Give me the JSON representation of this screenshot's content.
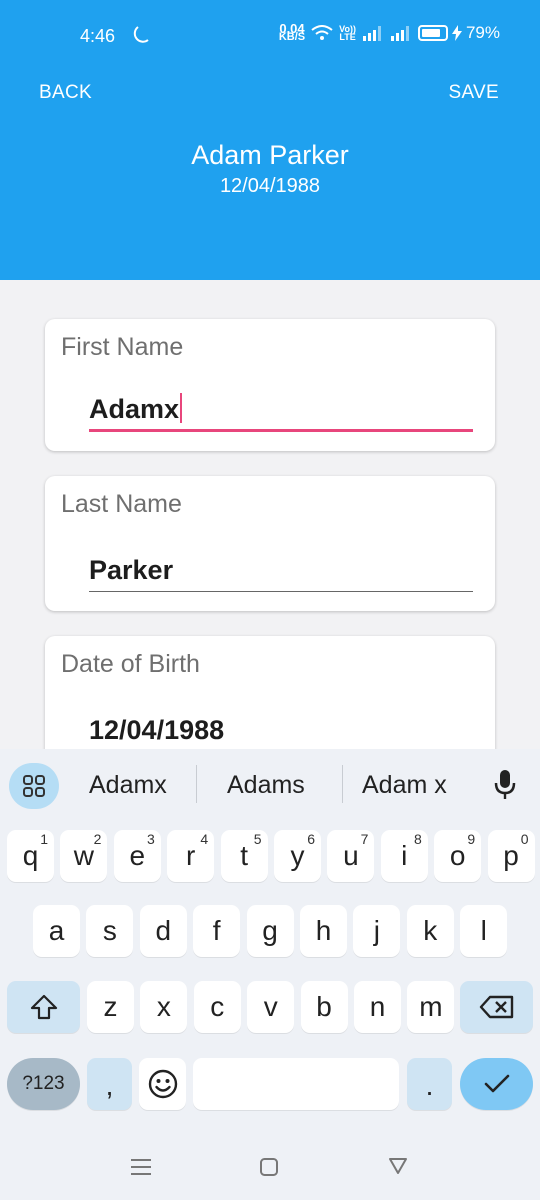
{
  "status_bar": {
    "time": "4:46",
    "net_speed_value": "0.04",
    "net_speed_unit": "KB/S",
    "volte_line1": "Vo))",
    "volte_line2": "LTE",
    "battery": "79%"
  },
  "header": {
    "back_label": "BACK",
    "save_label": "SAVE",
    "name": "Adam Parker",
    "dob": "12/04/1988",
    "bg_color": "#1fa1ef"
  },
  "form": {
    "first_name": {
      "label": "First Name",
      "value": "Adamx"
    },
    "last_name": {
      "label": "Last Name",
      "value": "Parker"
    },
    "date_of_birth": {
      "label": "Date of Birth",
      "value": "12/04/1988"
    }
  },
  "keyboard": {
    "suggestions": [
      "Adamx",
      "Adams",
      "Adam x"
    ],
    "row1": [
      {
        "k": "q",
        "h": "1"
      },
      {
        "k": "w",
        "h": "2"
      },
      {
        "k": "e",
        "h": "3"
      },
      {
        "k": "r",
        "h": "4"
      },
      {
        "k": "t",
        "h": "5"
      },
      {
        "k": "y",
        "h": "6"
      },
      {
        "k": "u",
        "h": "7"
      },
      {
        "k": "i",
        "h": "8"
      },
      {
        "k": "o",
        "h": "9"
      },
      {
        "k": "p",
        "h": "0"
      }
    ],
    "row2": [
      "a",
      "s",
      "d",
      "f",
      "g",
      "h",
      "j",
      "k",
      "l"
    ],
    "row3": [
      "z",
      "x",
      "c",
      "v",
      "b",
      "n",
      "m"
    ],
    "sym_label": "?123",
    "comma_label": ",",
    "period_label": "."
  }
}
